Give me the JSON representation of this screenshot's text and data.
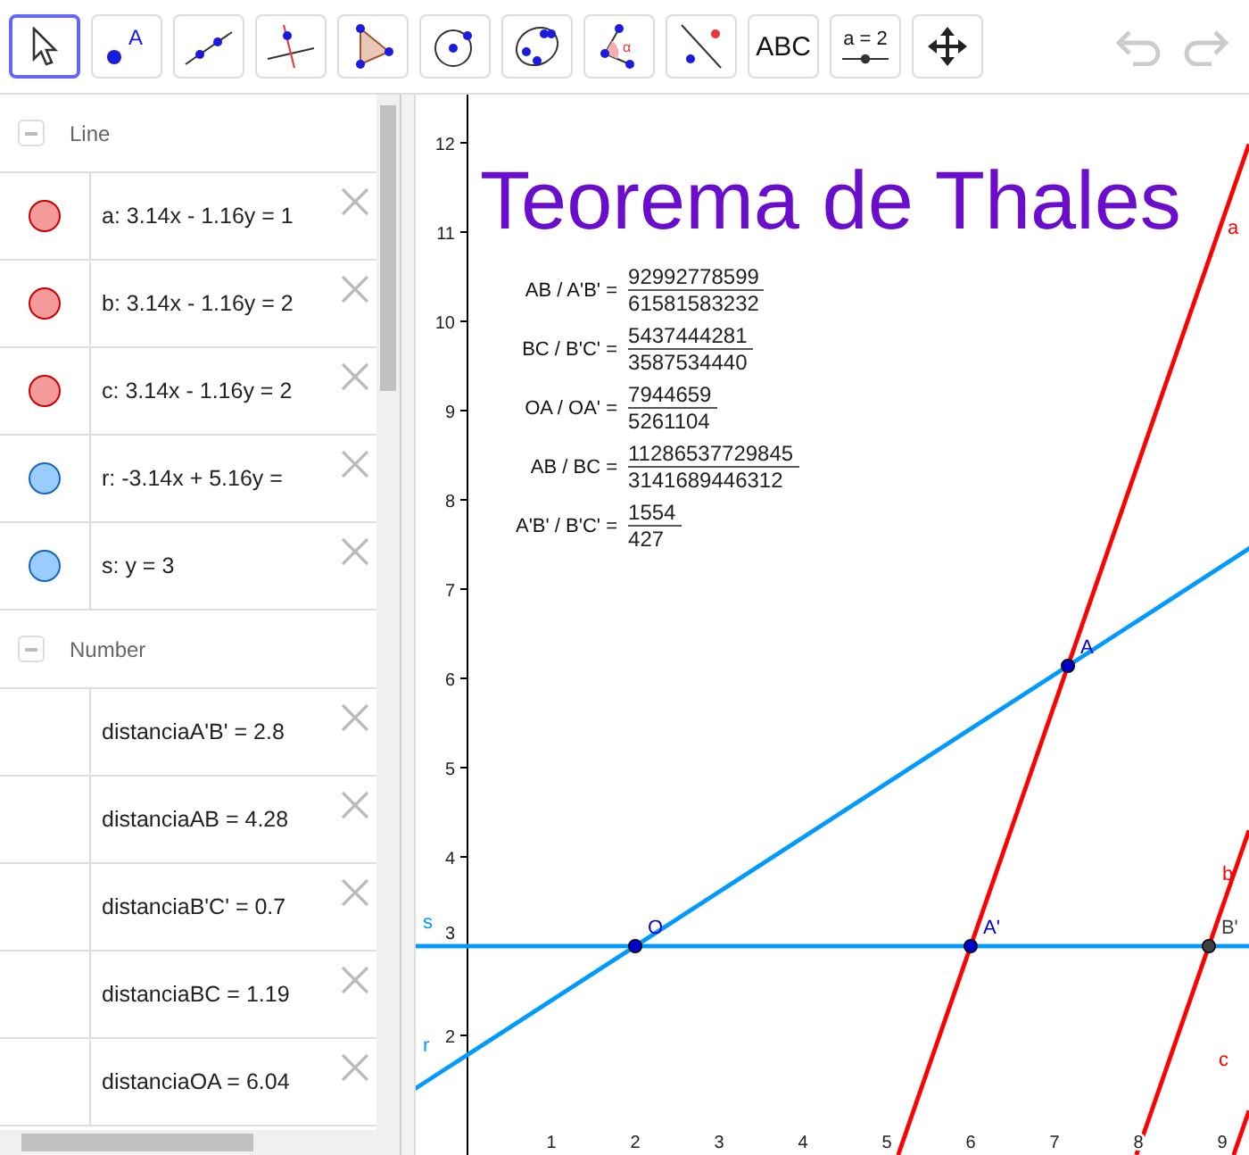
{
  "toolbar": {
    "tools": [
      {
        "kind": "move",
        "selected": true
      },
      {
        "kind": "point",
        "selected": false,
        "label": "A"
      },
      {
        "kind": "line",
        "selected": false
      },
      {
        "kind": "perpendicular",
        "selected": false
      },
      {
        "kind": "polygon",
        "selected": false
      },
      {
        "kind": "circle",
        "selected": false
      },
      {
        "kind": "conic",
        "selected": false
      },
      {
        "kind": "angle",
        "selected": false,
        "label": "α"
      },
      {
        "kind": "reflect",
        "selected": false
      },
      {
        "kind": "text",
        "selected": false,
        "label": "ABC"
      },
      {
        "kind": "slider",
        "selected": false,
        "label": "a = 2"
      },
      {
        "kind": "move-view",
        "selected": false
      }
    ]
  },
  "algebra": {
    "sections": [
      {
        "title": "Line",
        "items": [
          {
            "text": "a: 3.14x - 1.16y = 1",
            "color": "#f49a9a"
          },
          {
            "text": "b: 3.14x - 1.16y = 2",
            "color": "#f49a9a"
          },
          {
            "text": "c: 3.14x - 1.16y = 2",
            "color": "#f49a9a"
          },
          {
            "text": "r: -3.14x + 5.16y =",
            "color": "#99ccff"
          },
          {
            "text": "s: y = 3",
            "color": "#99ccff"
          }
        ]
      },
      {
        "title": "Number",
        "items": [
          {
            "text": "distanciaA'B' = 2.8"
          },
          {
            "text": "distanciaAB = 4.28"
          },
          {
            "text": "distanciaB'C' = 0.7"
          },
          {
            "text": "distanciaBC = 1.19"
          },
          {
            "text": "distanciaOA = 6.04"
          }
        ]
      }
    ]
  },
  "graphics": {
    "title": "Teorema de Thales",
    "ratios": [
      {
        "label": "AB / A'B' =",
        "numerator": "92992778599",
        "denominator": "61581583232"
      },
      {
        "label": "BC / B'C' =",
        "numerator": "5437444281",
        "denominator": "3587534440"
      },
      {
        "label": "OA / OA' =",
        "numerator": "7944659",
        "denominator": "5261104"
      },
      {
        "label": "AB / BC =",
        "numerator": "11286537729845",
        "denominator": "3141689446312"
      },
      {
        "label": "A'B' / B'C' =",
        "numerator": "1554",
        "denominator": "427"
      }
    ],
    "x_ticks": [
      "1",
      "2",
      "3",
      "4",
      "5",
      "6",
      "7",
      "8",
      "9"
    ],
    "y_ticks": [
      "12",
      "11",
      "10",
      "9",
      "8",
      "7",
      "6",
      "5",
      "4",
      "3",
      "2"
    ],
    "lines": [
      {
        "label": "a",
        "color": "#ff0000"
      },
      {
        "label": "b",
        "color": "#ff0000"
      },
      {
        "label": "c",
        "color": "#ff0000"
      },
      {
        "label": "r",
        "color": "#0099ff"
      },
      {
        "label": "s",
        "color": "#0099ff"
      }
    ],
    "points": [
      {
        "label": "O",
        "color": "#0000cc"
      },
      {
        "label": "A",
        "color": "#0000cc"
      },
      {
        "label": "A'",
        "color": "#0000cc"
      },
      {
        "label": "B'",
        "color": "#404040"
      }
    ]
  }
}
